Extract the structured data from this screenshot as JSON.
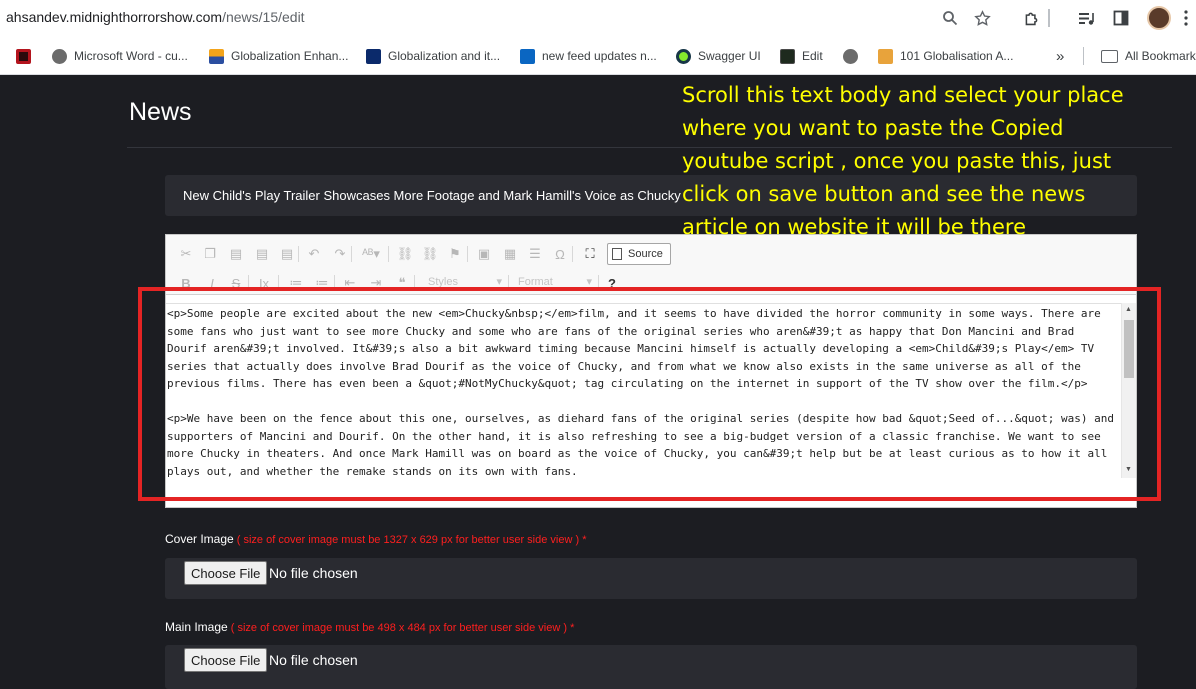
{
  "browser": {
    "url_host": "ahsandev.midnighthorrorshow.com",
    "url_path": "/news/15/edit",
    "bookmarks": [
      {
        "label": "",
        "icon": "red-dark-favicon",
        "color": "#b3141d"
      },
      {
        "label": "Microsoft Word - cu...",
        "icon": "globe-icon",
        "color": "#6b6b6b"
      },
      {
        "label": "Globalization Enhan...",
        "icon": "sunrise-favicon",
        "color": "#2b4ea0"
      },
      {
        "label": "Globalization and it...",
        "icon": "ubc-favicon",
        "color": "#0b2a6b"
      },
      {
        "label": "new feed updates n...",
        "icon": "linkedin-icon",
        "color": "#0a66c2"
      },
      {
        "label": "Swagger UI",
        "icon": "swagger-icon",
        "color": "#85ea2d"
      },
      {
        "label": "Edit",
        "icon": "terminal-favicon",
        "color": "#1e2a1e"
      },
      {
        "label": "",
        "icon": "globe-icon",
        "color": "#6b6b6b"
      },
      {
        "label": "101 Globalisation A...",
        "icon": "scholar-favicon",
        "color": "#e8a33b"
      }
    ],
    "more_label": "»",
    "all_bookmarks_label": "All Bookmarks"
  },
  "page": {
    "title": "News",
    "headline_value": "New Child's Play Trailer Showcases More Footage and Mark Hamill's Voice as Chucky"
  },
  "editor": {
    "source_label": "Source",
    "styles_label": "Styles",
    "format_label": "Format",
    "source_text": "<p>Some people are excited about the new <em>Chucky&nbsp;</em>film, and it seems to have divided the horror community in some ways. There are some fans who just want to see more Chucky and some who are fans of the original series who aren&#39;t as happy that Don Mancini and Brad Dourif aren&#39;t involved. It&#39;s also a bit awkward timing because Mancini himself is actually developing a <em>Child&#39;s Play</em> TV series that actually does involve Brad Dourif as the voice of Chucky, and from what we know also exists in the same universe as all of the previous films. There has even been a &quot;#NotMyChucky&quot; tag circulating on the internet in support of the TV show over the film.</p>\n\n<p>We have been on the fence about this one, ourselves, as diehard fans of the original series (despite how bad &quot;Seed of...&quot; was) and supporters of Mancini and Dourif. On the other hand, it is also refreshing to see a big-budget version of a classic franchise. We want to see more Chucky in theaters. And once Mark Hamill was on board as the voice of Chucky, you can&#39;t help but be at least curious as to how it all plays out, and whether the remake stands on its own with fans."
  },
  "overlay": {
    "note": "Scroll this text body and select your place where you want to paste the Copied youtube script , once you paste this, just click on save button and see the news article on website it will be there"
  },
  "cover_image": {
    "label": "Cover Image",
    "hint": " ( size of cover image must be 1327 x 629 px for better user side view ) *",
    "button": "Choose File",
    "status": "No file chosen"
  },
  "main_image": {
    "label": "Main Image",
    "hint": " ( size of cover image must be 498 x 484 px for better user side view ) *",
    "button": "Choose File",
    "status": "No file chosen"
  },
  "colors": {
    "page_bg": "#1c1d22",
    "field_bg": "#2a2b31",
    "annotation_red": "#e42424",
    "overlay_yellow": "#ffff00",
    "required_hint": "#ff1f1f"
  }
}
